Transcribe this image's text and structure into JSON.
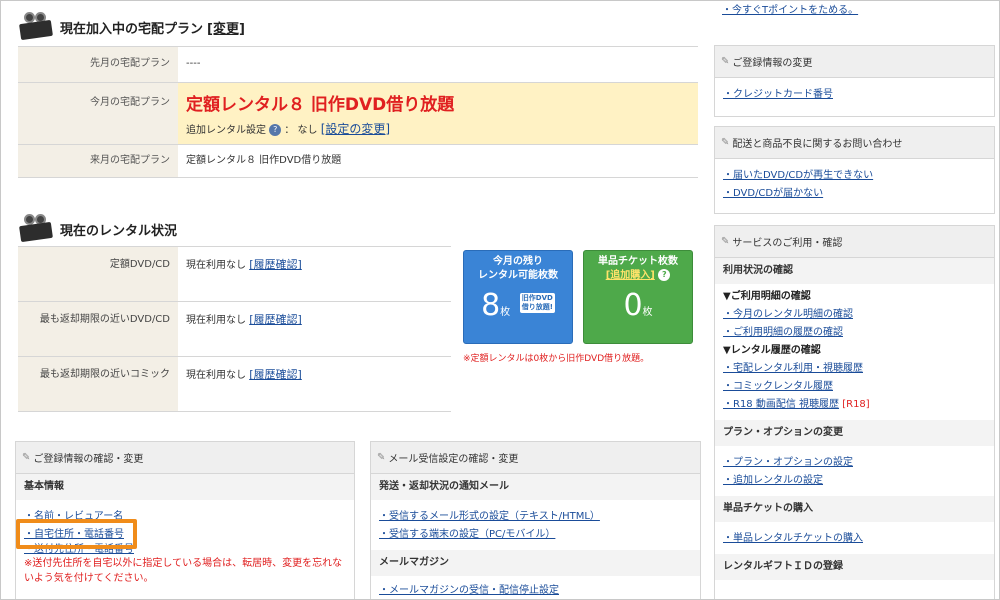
{
  "top_link": "・今すぐTポイントをためる。",
  "plan_section": {
    "title": "現在加入中の宅配プラン",
    "change_link": "[変更]",
    "rows": [
      {
        "label": "先月の宅配プラン",
        "value": "----"
      },
      {
        "label": "今月の宅配プラン",
        "value": "定額レンタル８ 旧作DVD借り放題",
        "sub_prefix": "追加レンタル設定",
        "sub_info": "?",
        "sub_value": "： なし",
        "sub_link": "[設定の変更]"
      },
      {
        "label": "来月の宅配プラン",
        "value": "定額レンタル８ 旧作DVD借り放題"
      }
    ]
  },
  "rental_section": {
    "title": "現在のレンタル状況",
    "rows": [
      {
        "label": "定額DVD/CD",
        "value": "現在利用なし",
        "link": "[履歴確認]"
      },
      {
        "label": "最も返却期限の近いDVD/CD",
        "value": "現在利用なし",
        "link": "[履歴確認]"
      },
      {
        "label": "最も返却期限の近いコミック",
        "value": "現在利用なし",
        "link": "[履歴確認]"
      }
    ],
    "tile_remaining": {
      "title1": "今月の残り",
      "title2": "レンタル可能枚数",
      "number": "8",
      "unit": "枚",
      "badge1": "旧作DVD",
      "badge2": "借り放題!"
    },
    "tile_ticket": {
      "title": "単品チケット枚数",
      "link": "[追加購入]",
      "info": "?",
      "number": "0",
      "unit": "枚"
    },
    "note": "※定額レンタルは0枚から旧作DVD借り放題。"
  },
  "reg_box": {
    "title": "ご登録情報の確認・変更",
    "sub": "基本情報",
    "items": [
      "・名前・レビュアー名",
      "・自宅住所・電話番号",
      "・送付先住所・電話番号"
    ],
    "note": "※送付先住所を自宅以外に指定している場合は、転居時、変更を忘れないよう気を付けてください。"
  },
  "mail_box": {
    "title": "メール受信設定の確認・変更",
    "sub1": "発送・返却状況の通知メール",
    "items1": [
      "・受信するメール形式の設定（テキスト/HTML）",
      "・受信する端末の設定（PC/モバイル）"
    ],
    "sub2": "メールマガジン",
    "items2": [
      "・メールマガジンの受信・配信停止設定"
    ]
  },
  "side": {
    "change_box": {
      "title": "ご登録情報の変更",
      "items": [
        "・クレジットカード番号"
      ]
    },
    "delivery_box": {
      "title": "配送と商品不良に関するお問い合わせ",
      "items": [
        "・届いたDVD/CDが再生できない",
        "・DVD/CDが届かない"
      ]
    },
    "service_box": {
      "title": "サービスのご利用・確認",
      "sub1": "利用状況の確認",
      "head1": "▼ご利用明細の確認",
      "items1": [
        "・今月のレンタル明細の確認",
        "・ご利用明細の履歴の確認"
      ],
      "head2": "▼レンタル履歴の確認",
      "items2": [
        "・宅配レンタル利用・視聴履歴",
        "・コミックレンタル履歴",
        "・R18 動画配信 視聴履歴"
      ],
      "r18_tag": "[R18]",
      "sub2": "プラン・オプションの変更",
      "items3": [
        "・プラン・オプションの設定",
        "・追加レンタルの設定"
      ],
      "sub3": "単品チケットの購入",
      "items4": [
        "・単品レンタルチケットの購入"
      ],
      "sub4": "レンタルギフトＩＤの登録"
    }
  }
}
